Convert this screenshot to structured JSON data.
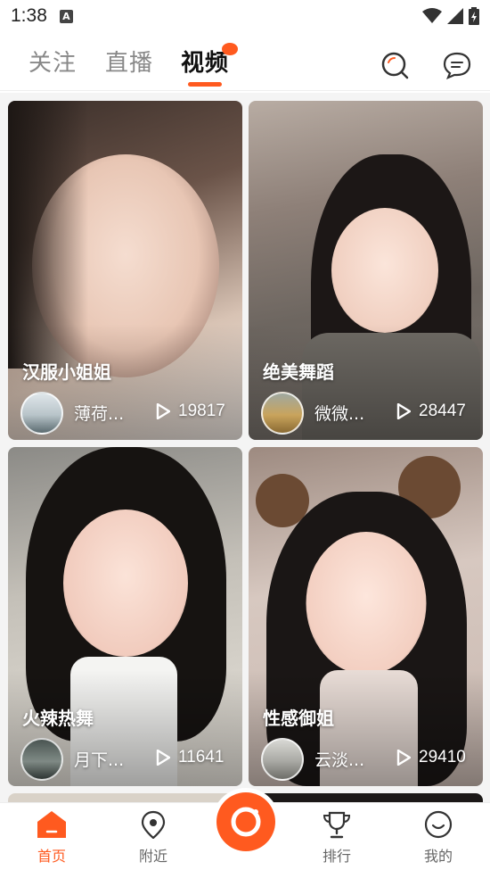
{
  "status_bar": {
    "time": "1:38",
    "notification_icon": "A"
  },
  "top_tabs": [
    {
      "label": "关注",
      "active": false
    },
    {
      "label": "直播",
      "active": false
    },
    {
      "label": "视频",
      "active": true
    }
  ],
  "icons": {
    "search": "search-icon",
    "message": "message-icon",
    "play": "play-icon"
  },
  "cards": [
    {
      "title": "汉服小姐姐",
      "user": "薄荷...",
      "plays": "19817"
    },
    {
      "title": "绝美舞蹈",
      "user": "微微...",
      "plays": "28447"
    },
    {
      "title": "火辣热舞",
      "user": "月下...",
      "plays": "11641"
    },
    {
      "title": "性感御姐",
      "user": "云淡...",
      "plays": "29410"
    }
  ],
  "bottom_nav": [
    {
      "label": "首页",
      "active": true
    },
    {
      "label": "附近",
      "active": false
    },
    {
      "label": "排行",
      "active": false
    },
    {
      "label": "我的",
      "active": false
    }
  ],
  "colors": {
    "accent": "#ff5a1f",
    "tab_inactive": "#888888"
  }
}
